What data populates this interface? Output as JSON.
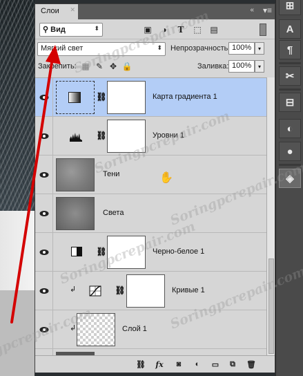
{
  "panel": {
    "tab_label": "Слои",
    "filter_label": "Вид",
    "blend_mode": "Мягкий свет",
    "opacity_label": "Непрозрачность:",
    "opacity_value": "100%",
    "lock_label": "Закрепить:",
    "fill_label": "Заливка:",
    "fill_value": "100%"
  },
  "layers": [
    {
      "name": "Карта градиента 1",
      "selected": true
    },
    {
      "name": "Уровни 1"
    },
    {
      "name": "Тени"
    },
    {
      "name": "Света"
    },
    {
      "name": "Черно-белое 1"
    },
    {
      "name": "Кривые 1"
    },
    {
      "name": "Слой 1"
    }
  ],
  "watermark": "Soringpcrepair.com",
  "colors": {
    "selection": "#b3cdf6",
    "arrow": "#d40000",
    "panel_bg": "#d6d6d6"
  },
  "bottom_icons": [
    "link-icon",
    "fx-icon",
    "mask-icon",
    "adjustment-icon",
    "folder-icon",
    "new-layer-icon",
    "trash-icon"
  ]
}
